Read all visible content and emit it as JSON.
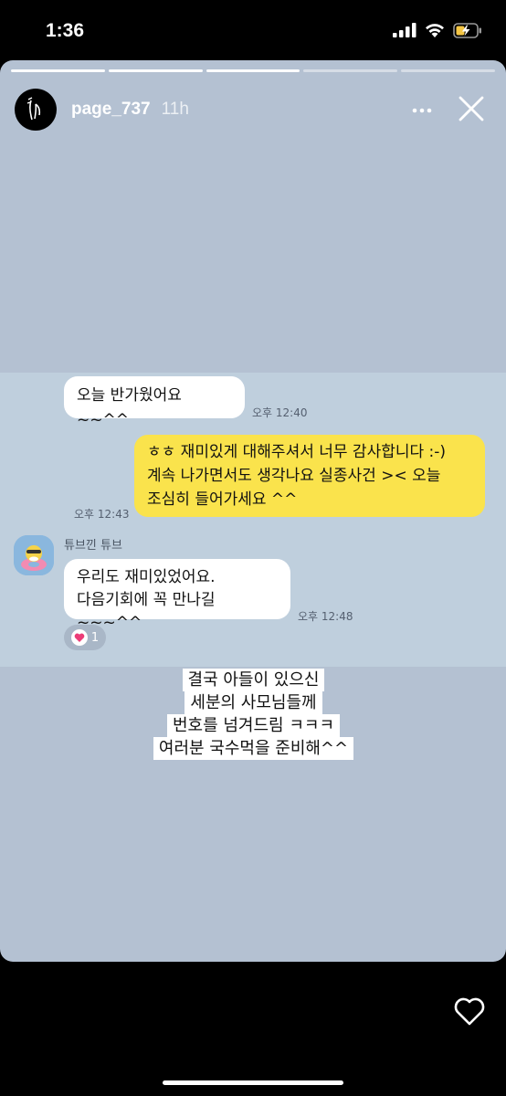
{
  "status": {
    "time": "1:36"
  },
  "story": {
    "progress": {
      "total_segments": 5,
      "completed_segments": 3
    },
    "username": "page_737",
    "age": "11h"
  },
  "chat": {
    "msg1": {
      "text": "오늘 반가웠어요~~^^",
      "time": "오후 12:40"
    },
    "msg2": {
      "lines": [
        "ㅎㅎ 재미있게 대해주셔서 너무 감사합니다 :-)",
        "계속 나가면서도 생각나요 실종사건 >< 오늘",
        "조심히 들어가세요 ^^"
      ],
      "time": "오후 12:43"
    },
    "sender_name": "튜브낀 튜브",
    "msg3": {
      "lines": [
        "우리도 재미있었어요.",
        "다음기회에 꼭 만나길~~~^^"
      ],
      "time": "오후 12:48"
    },
    "reaction_count": "1"
  },
  "caption": {
    "lines": [
      "결국 아들이 있으신",
      "세분의 사모님들께",
      "번호를 넘겨드림 ㅋㅋㅋ",
      "여러분 국수먹을 준비해^^"
    ]
  },
  "colors": {
    "chat_bg": "#bfcfdd",
    "story_bg": "#b4c1d2",
    "my_bubble": "#fae34c"
  }
}
